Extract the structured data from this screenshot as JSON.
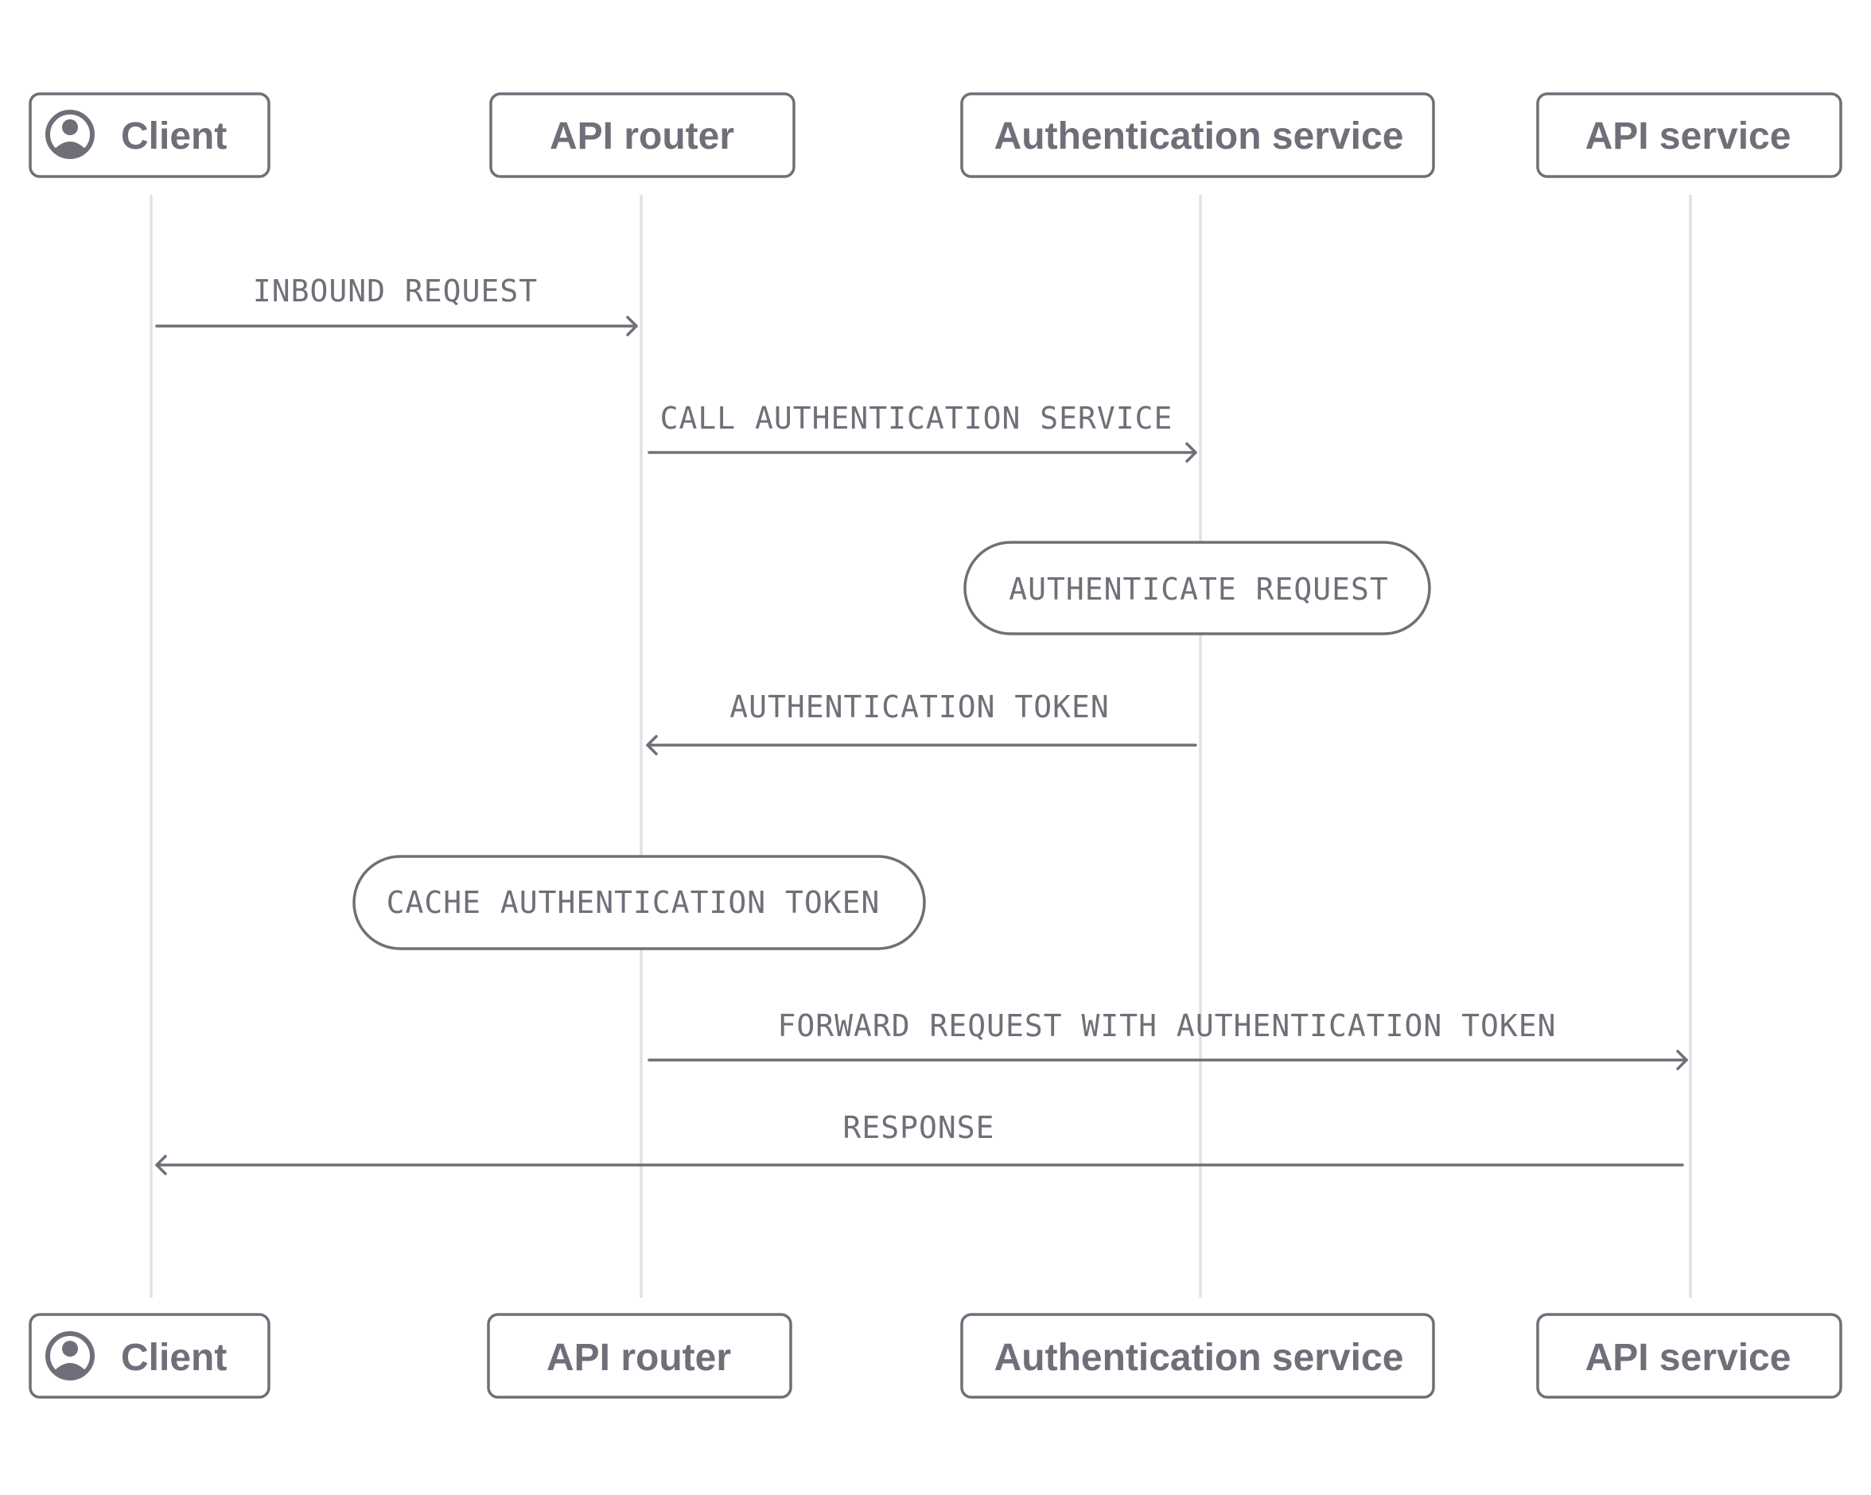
{
  "participants": [
    {
      "id": "client",
      "label": "Client",
      "icon": "user-avatar-icon"
    },
    {
      "id": "router",
      "label": "API router"
    },
    {
      "id": "auth",
      "label": "Authentication service"
    },
    {
      "id": "api",
      "label": "API service"
    }
  ],
  "steps": [
    {
      "type": "message",
      "from": "client",
      "to": "router",
      "label": "INBOUND REQUEST"
    },
    {
      "type": "message",
      "from": "router",
      "to": "auth",
      "label": "CALL AUTHENTICATION SERVICE"
    },
    {
      "type": "action",
      "at": "auth",
      "label": "AUTHENTICATE REQUEST"
    },
    {
      "type": "message",
      "from": "auth",
      "to": "router",
      "label": "AUTHENTICATION TOKEN"
    },
    {
      "type": "action",
      "at": "router",
      "label": "CACHE AUTHENTICATION TOKEN"
    },
    {
      "type": "message",
      "from": "router",
      "to": "api",
      "label": "FORWARD REQUEST WITH AUTHENTICATION TOKEN"
    },
    {
      "type": "message",
      "from": "api",
      "to": "client",
      "label": "RESPONSE"
    }
  ],
  "colors": {
    "stroke": "#706f79",
    "lifeline": "#e2e2e4",
    "background": "#ffffff"
  }
}
